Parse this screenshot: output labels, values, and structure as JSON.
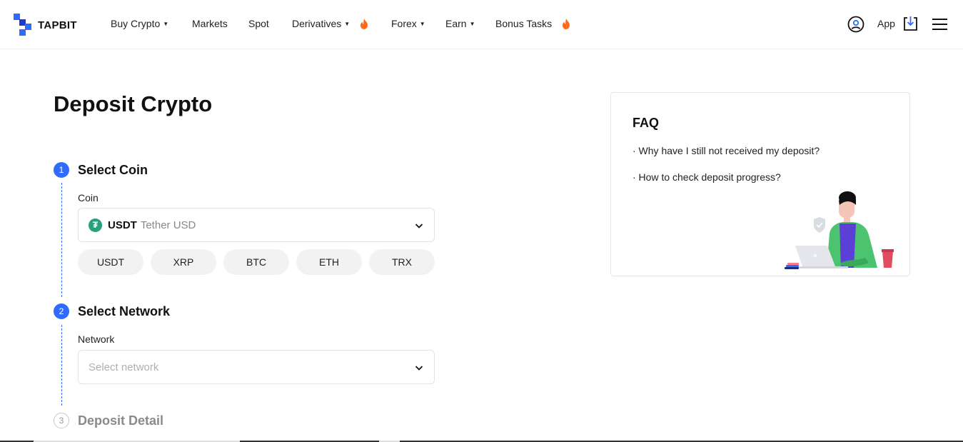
{
  "brand": {
    "name": "TAPBIT"
  },
  "nav": {
    "items": [
      {
        "label": "Buy Crypto",
        "has_caret": true,
        "hot": false
      },
      {
        "label": "Markets",
        "has_caret": false,
        "hot": false
      },
      {
        "label": "Spot",
        "has_caret": false,
        "hot": false
      },
      {
        "label": "Derivatives",
        "has_caret": true,
        "hot": true
      },
      {
        "label": "Forex",
        "has_caret": true,
        "hot": false
      },
      {
        "label": "Earn",
        "has_caret": true,
        "hot": false
      },
      {
        "label": "Bonus Tasks",
        "has_caret": false,
        "hot": true
      }
    ],
    "caret_glyph": "▼",
    "app_label": "App",
    "icons": [
      "user-icon",
      "download-icon",
      "hamburger-menu-icon",
      "flame-icon"
    ]
  },
  "page": {
    "title": "Deposit Crypto"
  },
  "steps": [
    {
      "number": "1",
      "title": "Select Coin",
      "active": true
    },
    {
      "number": "2",
      "title": "Select Network",
      "active": true
    },
    {
      "number": "3",
      "title": "Deposit Detail",
      "active": false
    }
  ],
  "coin": {
    "label": "Coin",
    "selected_symbol": "USDT",
    "selected_name": "Tether USD",
    "logo_glyph": "₮",
    "quick_picks": [
      "USDT",
      "XRP",
      "BTC",
      "ETH",
      "TRX"
    ]
  },
  "network": {
    "label": "Network",
    "placeholder": "Select network"
  },
  "faq": {
    "title": "FAQ",
    "links": [
      "· Why have I still not received my deposit?",
      "· How to check deposit progress?"
    ]
  },
  "colors": {
    "accent": "#2f6bff",
    "flame": "#ff6a1a",
    "tether": "#26a17b",
    "illustration_shirt": "#5b3fd6",
    "illustration_jacket": "#4cc36e"
  }
}
